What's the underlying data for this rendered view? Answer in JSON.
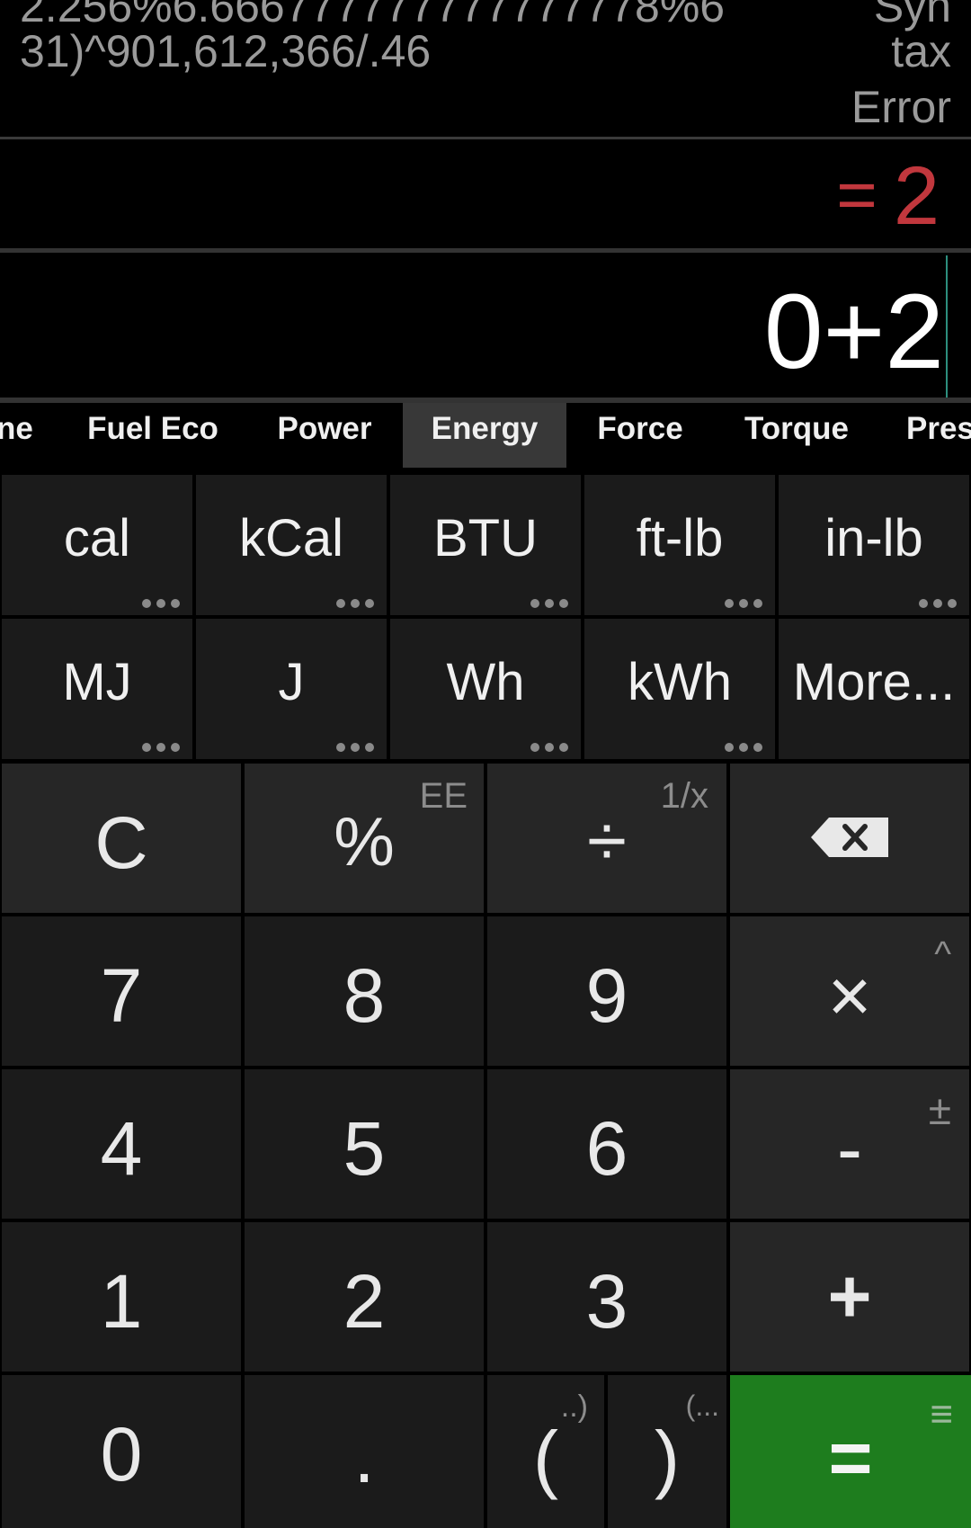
{
  "history": {
    "line1": "2.256%6.666777777777777778%6",
    "line2": "31)^901,612,366/.46",
    "error_line1": "Syn",
    "error_line2": "tax",
    "error_line3": "Error"
  },
  "result": {
    "prefix": "=",
    "value": "2"
  },
  "input": {
    "expression": "0+2"
  },
  "tabs": [
    {
      "label": "ne"
    },
    {
      "label": "Fuel Eco"
    },
    {
      "label": "Power"
    },
    {
      "label": "Energy",
      "active": true
    },
    {
      "label": "Force"
    },
    {
      "label": "Torque"
    },
    {
      "label": "Pres"
    }
  ],
  "units": [
    {
      "label": "cal"
    },
    {
      "label": "kCal"
    },
    {
      "label": "BTU"
    },
    {
      "label": "ft-lb"
    },
    {
      "label": "in-lb"
    },
    {
      "label": "MJ"
    },
    {
      "label": "J"
    },
    {
      "label": "Wh"
    },
    {
      "label": "kWh"
    },
    {
      "label": "More..."
    }
  ],
  "keys": {
    "clear": "C",
    "percent": "%",
    "percent_alt": "EE",
    "divide": "÷",
    "divide_alt": "1/x",
    "backspace_icon": "backspace-icon",
    "k7": "7",
    "k8": "8",
    "k9": "9",
    "multiply": "×",
    "multiply_alt": "^",
    "k4": "4",
    "k5": "5",
    "k6": "6",
    "minus": "-",
    "minus_alt": "±",
    "k1": "1",
    "k2": "2",
    "k3": "3",
    "plus": "+",
    "k0": "0",
    "dot": ".",
    "lparen": "(",
    "lparen_alt": "..)",
    "rparen": ")",
    "rparen_alt": "(...",
    "equals": "=",
    "equals_alt": "≡"
  },
  "colors": {
    "accent_result": "#c1373d",
    "equals_key": "#1e7d1e",
    "caret": "#2d8f7f"
  }
}
